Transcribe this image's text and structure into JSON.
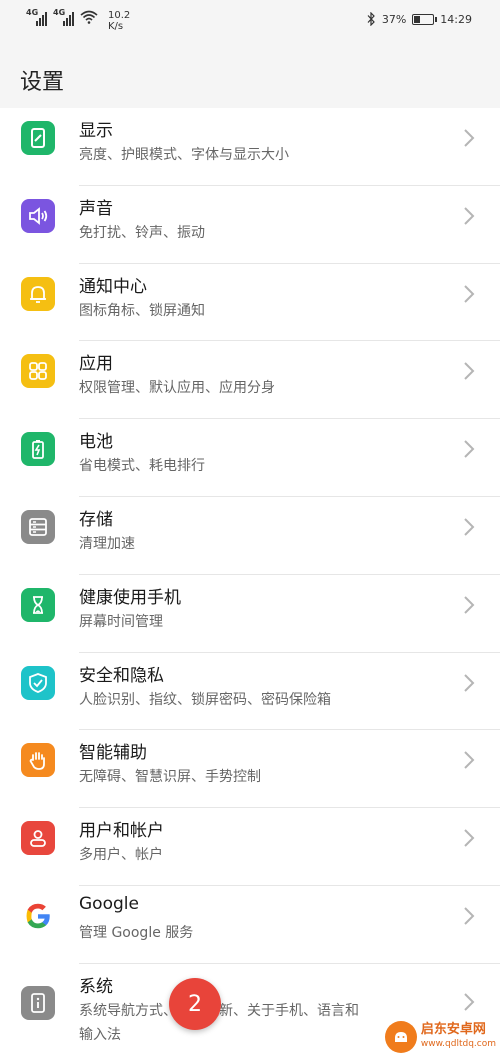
{
  "status_bar": {
    "sim1": "4G",
    "sim2": "4G",
    "speed_value": "10.2",
    "speed_unit": "K/s",
    "battery_percent": "37%",
    "battery_level": 0.37,
    "time": "14:29"
  },
  "header": {
    "title": "设置"
  },
  "items": [
    {
      "title": "显示",
      "subtitle": "亮度、护眼模式、字体与显示大小",
      "icon": "display-icon",
      "color": "#1fb66a"
    },
    {
      "title": "声音",
      "subtitle": "免打扰、铃声、振动",
      "icon": "sound-icon",
      "color": "#7b55e0"
    },
    {
      "title": "通知中心",
      "subtitle": "图标角标、锁屏通知",
      "icon": "bell-icon",
      "color": "#f5bf12"
    },
    {
      "title": "应用",
      "subtitle": "权限管理、默认应用、应用分身",
      "icon": "apps-icon",
      "color": "#f5bf12"
    },
    {
      "title": "电池",
      "subtitle": "省电模式、耗电排行",
      "icon": "battery-icon",
      "color": "#1fb66a"
    },
    {
      "title": "存储",
      "subtitle": "清理加速",
      "icon": "storage-icon",
      "color": "#8a8a8a"
    },
    {
      "title": "健康使用手机",
      "subtitle": "屏幕时间管理",
      "icon": "hourglass-icon",
      "color": "#1fb66a"
    },
    {
      "title": "安全和隐私",
      "subtitle": "人脸识别、指纹、锁屏密码、密码保险箱",
      "icon": "shield-icon",
      "color": "#1ec3c9"
    },
    {
      "title": "智能辅助",
      "subtitle": "无障碍、智慧识屏、手势控制",
      "icon": "hand-icon",
      "color": "#f58a1f"
    },
    {
      "title": "用户和帐户",
      "subtitle": "多用户、帐户",
      "icon": "user-icon",
      "color": "#e8473d"
    },
    {
      "title": "Google",
      "subtitle": "管理 Google 服务",
      "icon": "google-icon",
      "color": "#ffffff"
    },
    {
      "title": "系统",
      "subtitle": "系统导航方式、软件更新、关于手机、语言和",
      "subtitle2": "输入法",
      "icon": "info-icon",
      "color": "#8a8a8a"
    }
  ],
  "badge": {
    "label": "2",
    "color": "#e8443a"
  },
  "watermark": {
    "name": "启东安卓网",
    "url": "www.qdltdq.com"
  }
}
